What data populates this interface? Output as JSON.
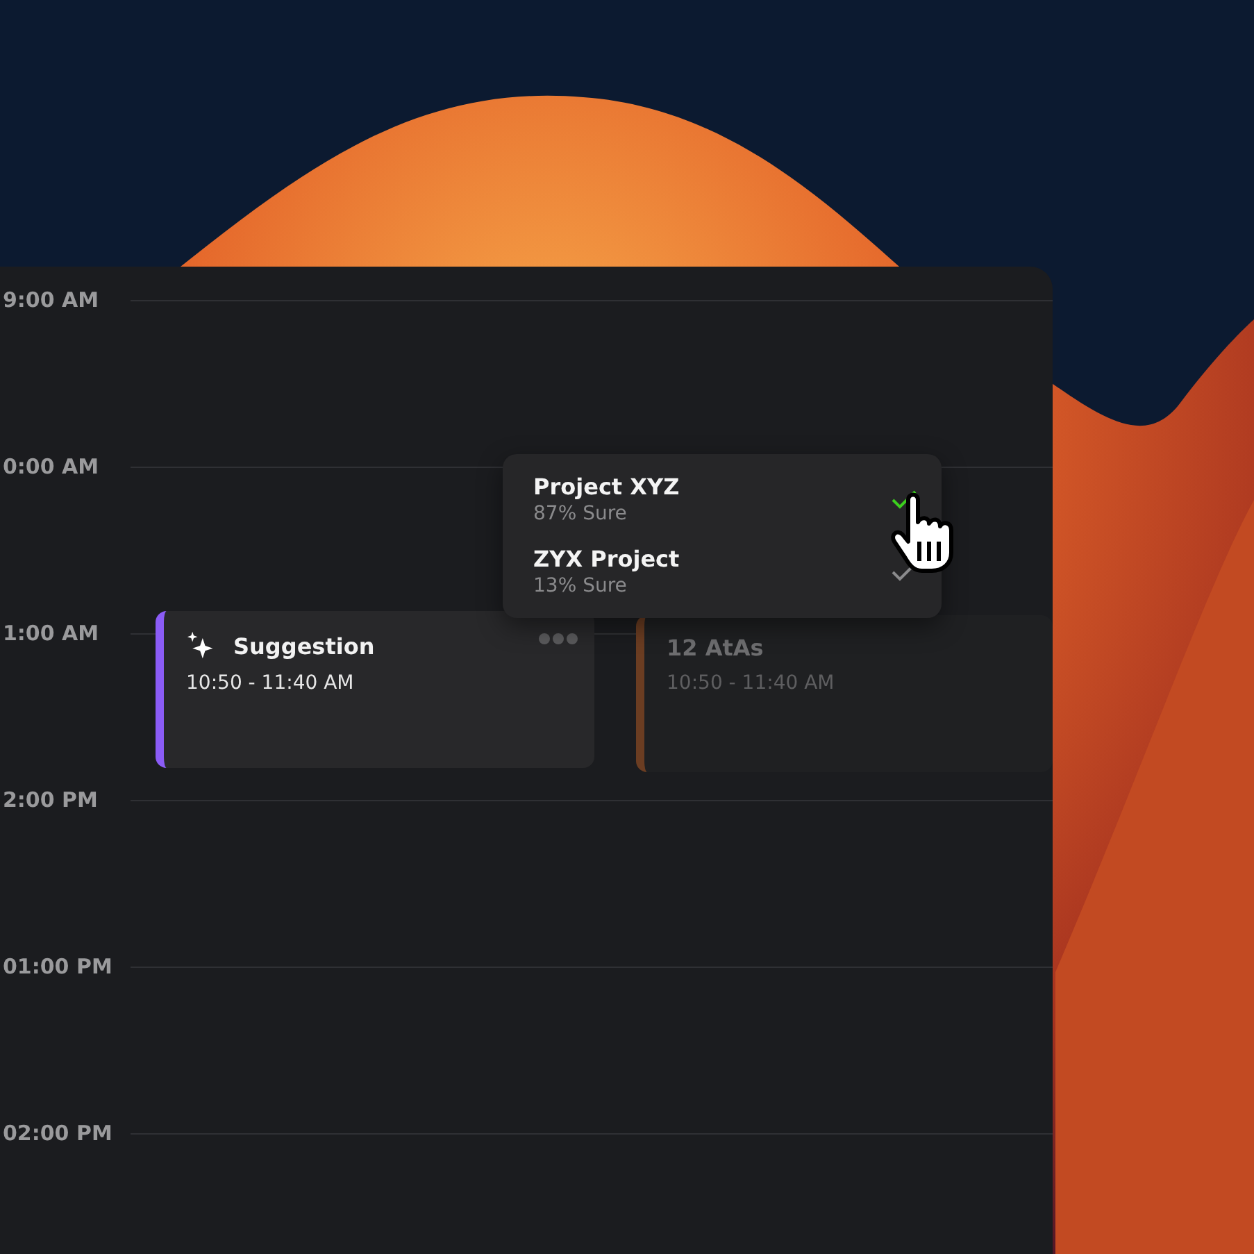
{
  "timeline": {
    "hours": [
      "9:00 AM",
      "0:00 AM",
      "1:00 AM",
      "2:00 PM",
      "01:00 PM",
      "02:00 PM"
    ]
  },
  "events": [
    {
      "kind": "suggestion",
      "title": "Suggestion",
      "time": "10:50 - 11:40 AM",
      "color": "#8b5cf6"
    },
    {
      "kind": "dimmed",
      "title": "12 AtAs",
      "time": "10:50 - 11:40 AM",
      "color": "#6b3d22"
    }
  ],
  "popup": {
    "options": [
      {
        "name": "Project XYZ",
        "confidence": "87% Sure",
        "selected": true
      },
      {
        "name": "ZYX Project",
        "confidence": "13% Sure",
        "selected": false
      }
    ]
  }
}
